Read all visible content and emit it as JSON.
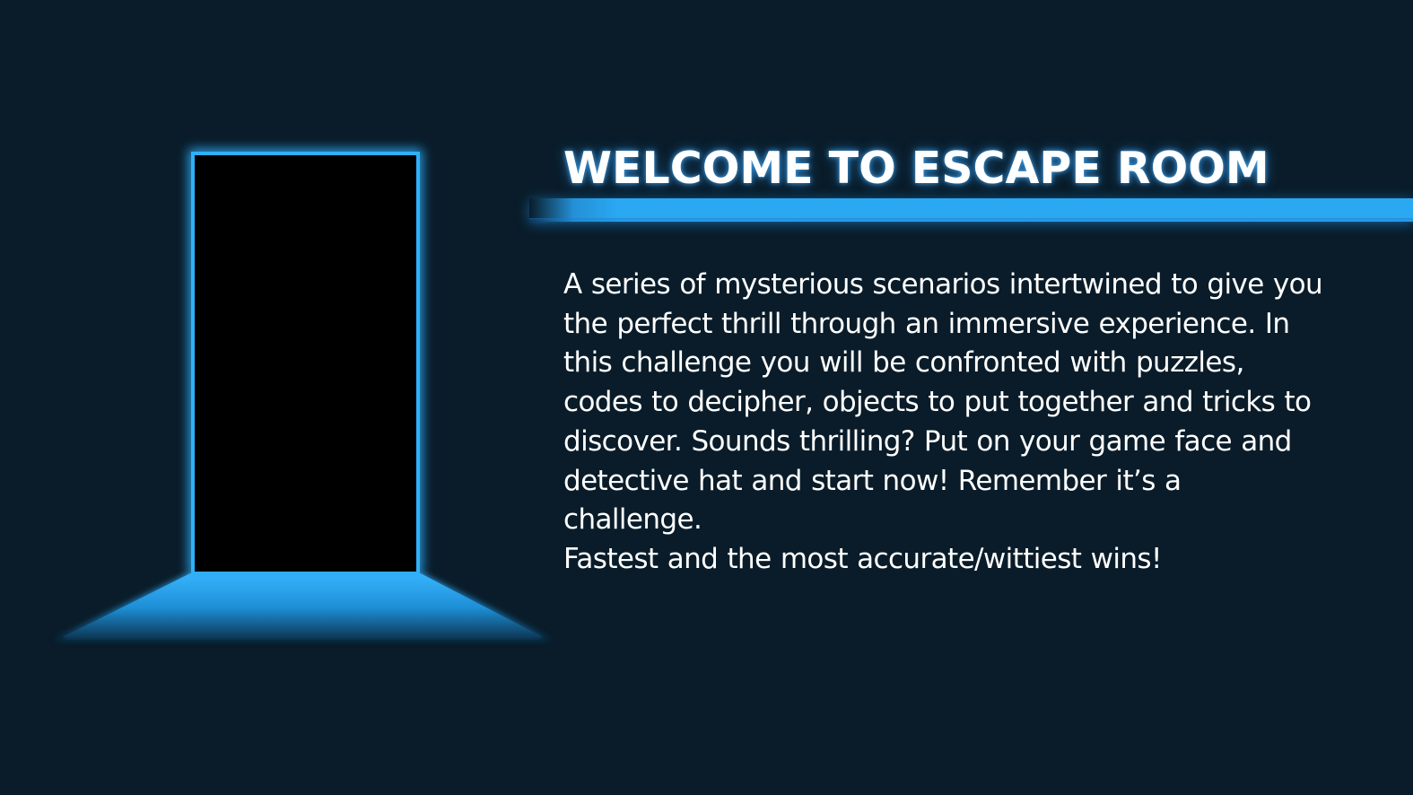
{
  "slide": {
    "title": "WELCOME TO ESCAPE ROOM",
    "description_lines": [
      "A series of mysterious scenarios intertwined to give you",
      "the perfect thrill through an immersive experience. In",
      "this challenge you will be confronted with puzzles,",
      "codes to decipher, objects to put together and tricks to",
      "discover. Sounds thrilling? Put on your game face and",
      "detective hat and start now! Remember it’s a",
      "challenge."
    ],
    "closing_line": "Fastest and the most accurate/wittiest wins!"
  },
  "colors": {
    "background": "#0a1c29",
    "accent_glow": "#2aa8f2",
    "door": "#000000",
    "text": "#ffffff"
  },
  "icons": {
    "door_illustration": "glowing-door-icon"
  }
}
